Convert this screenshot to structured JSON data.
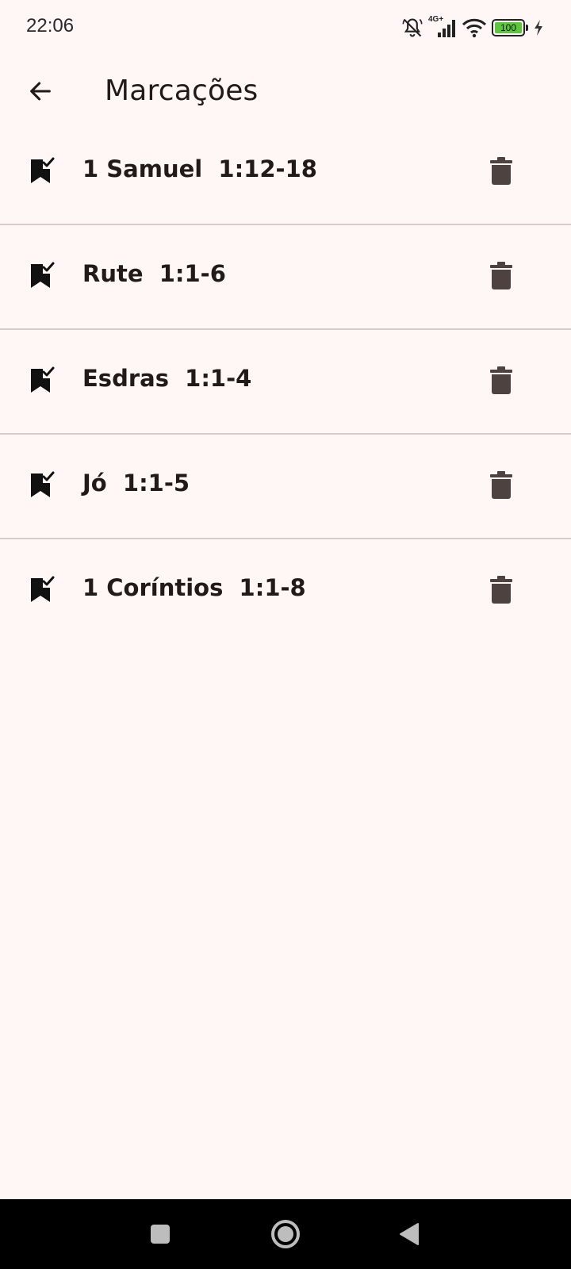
{
  "status_bar": {
    "time": "22:06",
    "network": "4G+",
    "battery_level": "100",
    "icons": [
      "mute-bell-icon",
      "signal-icon",
      "wifi-icon",
      "battery-icon",
      "charging-bolt-icon"
    ]
  },
  "app_bar": {
    "title": "Marcações",
    "back_icon": "arrow-back-icon"
  },
  "bookmarks": [
    {
      "label": "1 Samuel  1:12-18",
      "icon": "bookmark-check-icon",
      "action_icon": "trash-icon"
    },
    {
      "label": "Rute  1:1-6",
      "icon": "bookmark-check-icon",
      "action_icon": "trash-icon"
    },
    {
      "label": "Esdras  1:1-4",
      "icon": "bookmark-check-icon",
      "action_icon": "trash-icon"
    },
    {
      "label": "Jó  1:1-5",
      "icon": "bookmark-check-icon",
      "action_icon": "trash-icon"
    },
    {
      "label": "1 Coríntios  1:1-8",
      "icon": "bookmark-check-icon",
      "action_icon": "trash-icon"
    }
  ],
  "nav_bar": {
    "buttons": [
      "recents-square-icon",
      "home-circle-icon",
      "back-triangle-icon"
    ]
  },
  "colors": {
    "background": "#fff7f5",
    "text": "#221a19",
    "divider": "#d8ccc9",
    "trash": "#4e4240",
    "battery_fill": "#5ac83a"
  }
}
